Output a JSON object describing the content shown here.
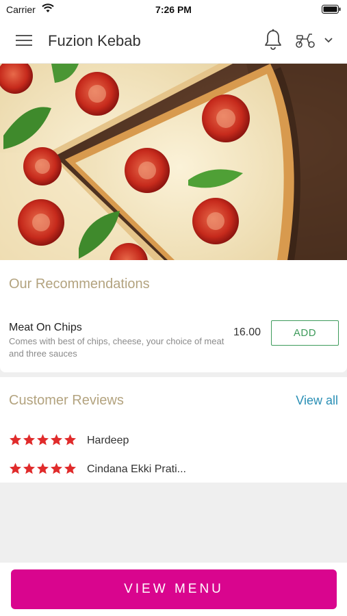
{
  "status_bar": {
    "carrier": "Carrier",
    "time": "7:26 PM"
  },
  "header": {
    "title": "Fuzion Kebab",
    "icons": [
      "menu-icon",
      "bell-icon",
      "scooter-icon",
      "chevron-down-icon"
    ]
  },
  "hero": {
    "icon": "pizza-image"
  },
  "recommendations": {
    "title": "Our Recommendations",
    "items": [
      {
        "name": "Meat On Chips",
        "description": "Comes with best of chips, cheese, your choice of meat and three sauces",
        "price": "16.00",
        "button_label": "ADD"
      }
    ]
  },
  "reviews": {
    "title": "Customer Reviews",
    "view_all_label": "View all",
    "items": [
      {
        "name": "Hardeep",
        "rating": 5
      },
      {
        "name": "Cindana Ekki Prati...",
        "rating": 5
      }
    ]
  },
  "footer": {
    "button_label": "VIEW MENU"
  },
  "colors": {
    "brand": "#d9058e",
    "section_title": "#b3a37f",
    "add_button": "#3d9a5a",
    "link": "#2a8fb5",
    "star": "#e02b2b"
  }
}
